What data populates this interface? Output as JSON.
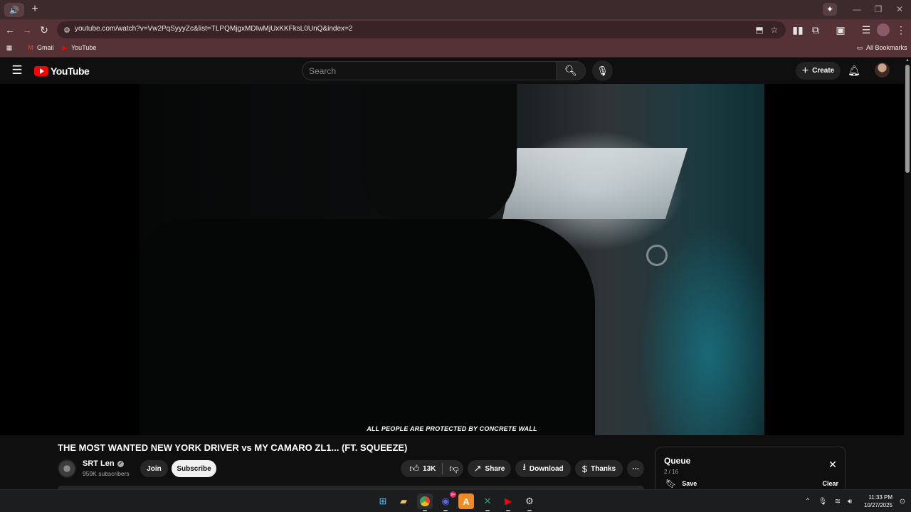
{
  "browser": {
    "new_tab_label": "+",
    "url": "youtube.com/watch?v=Vw2PqSyyyZc&list=TLPQMjgxMDIwMjUxKKFksL0UnQ&index=2",
    "bookmarks": [
      {
        "label": "Gmail",
        "icon": "gmail-icon"
      },
      {
        "label": "YouTube",
        "icon": "youtube-icon"
      }
    ],
    "all_bookmarks_label": "All Bookmarks",
    "colors": {
      "tabstrip": "#3c2a2c",
      "toolbar": "#553236",
      "omnibox": "#3a2326"
    }
  },
  "youtube": {
    "logo_text": "YouTube",
    "search_placeholder": "Search",
    "create_label": "Create",
    "video": {
      "subtitle": "ALL PEOPLE ARE PROTECTED BY CONCRETE WALL",
      "title": "THE MOST WANTED NEW YORK DRIVER vs MY CAMARO ZL1... (FT. SQUEEZE)"
    },
    "channel": {
      "name": "SRT Len",
      "subscribers": "959K subscribers",
      "verified": true
    },
    "actions": {
      "join": "Join",
      "subscribe": "Subscribe",
      "likes": "13K",
      "share": "Share",
      "download": "Download",
      "thanks": "Thanks"
    },
    "queue": {
      "title": "Queue",
      "position": "2 / 16",
      "save": "Save",
      "clear": "Clear"
    }
  },
  "taskbar": {
    "apps": [
      "windows-start-icon",
      "file-explorer-icon",
      "chrome-icon",
      "discord-icon",
      "app-icon",
      "excel-icon",
      "youtube-music-icon",
      "settings-app-icon"
    ],
    "discord_badge": "9+",
    "time": "11:33 PM",
    "date": "10/27/2025"
  }
}
